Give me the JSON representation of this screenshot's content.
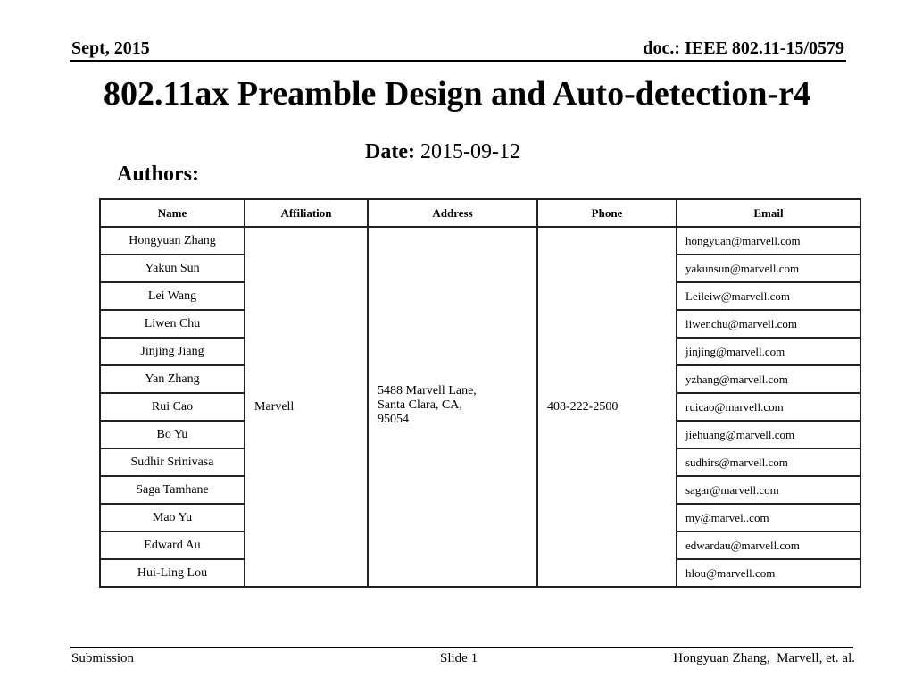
{
  "header": {
    "date": "Sept, 2015",
    "doc": "doc.: IEEE 802.11-15/0579"
  },
  "title": "802.11ax Preamble Design and Auto-detection-r4",
  "date_line": {
    "label": "Date:",
    "value": "2015-09-12"
  },
  "authors_label": "Authors:",
  "table": {
    "columns": [
      "Name",
      "Affiliation",
      "Address",
      "Phone",
      "Email"
    ],
    "affiliation": "Marvell",
    "address_lines": [
      "5488 Marvell Lane,",
      "Santa Clara, CA,",
      "95054"
    ],
    "phone": "408-222-2500",
    "rows": [
      {
        "name": "Hongyuan Zhang",
        "email": "hongyuan@marvell.com"
      },
      {
        "name": "Yakun Sun",
        "email": "yakunsun@marvell.com"
      },
      {
        "name": "Lei Wang",
        "email": "Leileiw@marvell.com"
      },
      {
        "name": "Liwen Chu",
        "email": "liwenchu@marvell.com"
      },
      {
        "name": "Jinjing Jiang",
        "email": "jinjing@marvell.com"
      },
      {
        "name": "Yan Zhang",
        "email": "yzhang@marvell.com"
      },
      {
        "name": "Rui Cao",
        "email": "ruicao@marvell.com"
      },
      {
        "name": "Bo Yu",
        "email": "jiehuang@marvell.com"
      },
      {
        "name": "Sudhir Srinivasa",
        "email": "sudhirs@marvell.com"
      },
      {
        "name": "Saga Tamhane",
        "email": "sagar@marvell.com"
      },
      {
        "name": "Mao Yu",
        "email": "my@marvel..com"
      },
      {
        "name": "Edward Au",
        "email": "edwardau@marvell.com"
      },
      {
        "name": "Hui-Ling Lou",
        "email": "hlou@marvell.com"
      }
    ]
  },
  "footer": {
    "left": "Submission",
    "center": "Slide 1",
    "right": "Hongyuan Zhang,  Marvell, et. al."
  }
}
